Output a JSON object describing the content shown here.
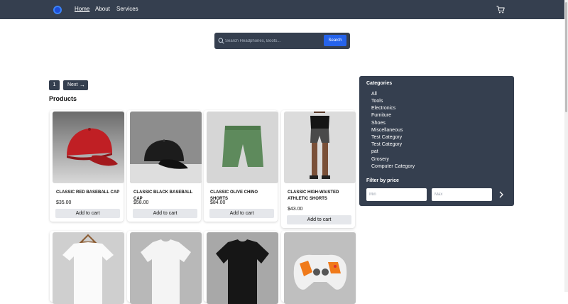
{
  "nav": {
    "links": {
      "home": "Home",
      "about": "About",
      "services": "Services"
    }
  },
  "search": {
    "placeholder": "Search Headphones, Boots...",
    "button": "Search"
  },
  "pagination": {
    "current": "1",
    "next": "Next"
  },
  "products_heading": "Products",
  "products": [
    {
      "name": "CLASSIC RED BASEBALL CAP",
      "price": "$35.00",
      "button": "Add to cart",
      "image": "red-cap"
    },
    {
      "name": "CLASSIC BLACK BASEBALL CAP",
      "price": "$58.00",
      "button": "Add to cart",
      "image": "black-cap"
    },
    {
      "name": "CLASSIC OLIVE CHINO SHORTS",
      "price": "$84.00",
      "button": "Add to cart",
      "image": "olive-shorts"
    },
    {
      "name": "CLASSIC HIGH-WAISTED ATHLETIC SHORTS",
      "price": "$43.00",
      "button": "Add to cart",
      "image": "athletic-shorts"
    },
    {
      "image": "white-tshirt-hanger"
    },
    {
      "image": "white-tshirt"
    },
    {
      "image": "black-tshirt"
    },
    {
      "image": "game-controller"
    }
  ],
  "sidebar": {
    "categories_title": "Categories",
    "categories": [
      "All",
      "Tools",
      "Electronics",
      "Furniture",
      "Shoes",
      "Miscellaneous",
      "Test Category",
      "Test Category",
      "pat",
      "Grosery",
      "Computer Category"
    ],
    "filter_title": "Filter by price",
    "min_placeholder": "Min",
    "max_placeholder": "Max"
  },
  "colors": {
    "navbar": "#353f4f",
    "accent": "#2563eb",
    "button_gray": "#e5e7eb"
  }
}
